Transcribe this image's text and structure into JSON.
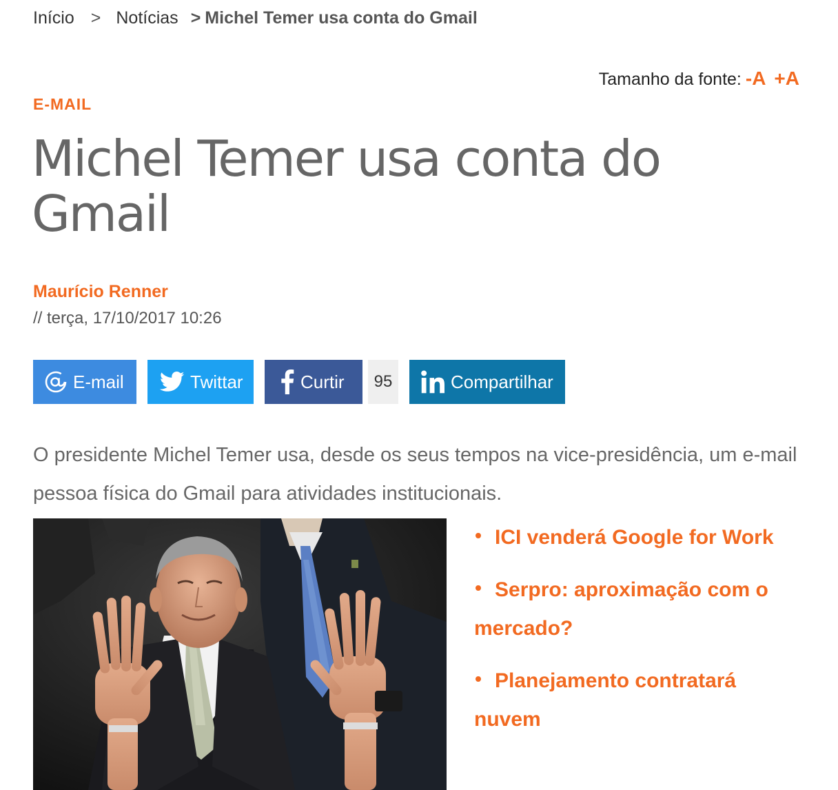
{
  "breadcrumb": {
    "home": "Início",
    "separator": ">",
    "news": "Notícias",
    "current": "Michel Temer usa conta do Gmail"
  },
  "font_size": {
    "label": "Tamanho da fonte:",
    "decrease": "-A",
    "increase": "+A"
  },
  "article": {
    "category": "E-MAIL",
    "title": "Michel Temer usa conta do Gmail",
    "author": "Maurício Renner",
    "date": "// terça, 17/10/2017 10:26",
    "lead": "O presidente Michel Temer usa, desde os seus tempos na vice-presidência, um e-mail pessoa física do Gmail para atividades institucionais."
  },
  "share": {
    "email_label": "E-mail",
    "twitter_label": "Twittar",
    "facebook_label": "Curtir",
    "facebook_count": "95",
    "linkedin_label": "Compartilhar"
  },
  "related": [
    {
      "label": "ICI venderá Google for Work"
    },
    {
      "label": "Serpro: aproximação com o mercado?"
    },
    {
      "label": "Planejamento contratará nuvem"
    }
  ],
  "colors": {
    "accent": "#f26a21",
    "email": "#3d8be0",
    "twitter": "#1da1f2",
    "facebook": "#3b5998",
    "linkedin": "#0e76a8"
  },
  "icons": {
    "email": "at-icon",
    "twitter": "twitter-bird-icon",
    "facebook": "facebook-f-icon",
    "linkedin": "linkedin-in-icon",
    "bullet": "bullet-icon"
  }
}
